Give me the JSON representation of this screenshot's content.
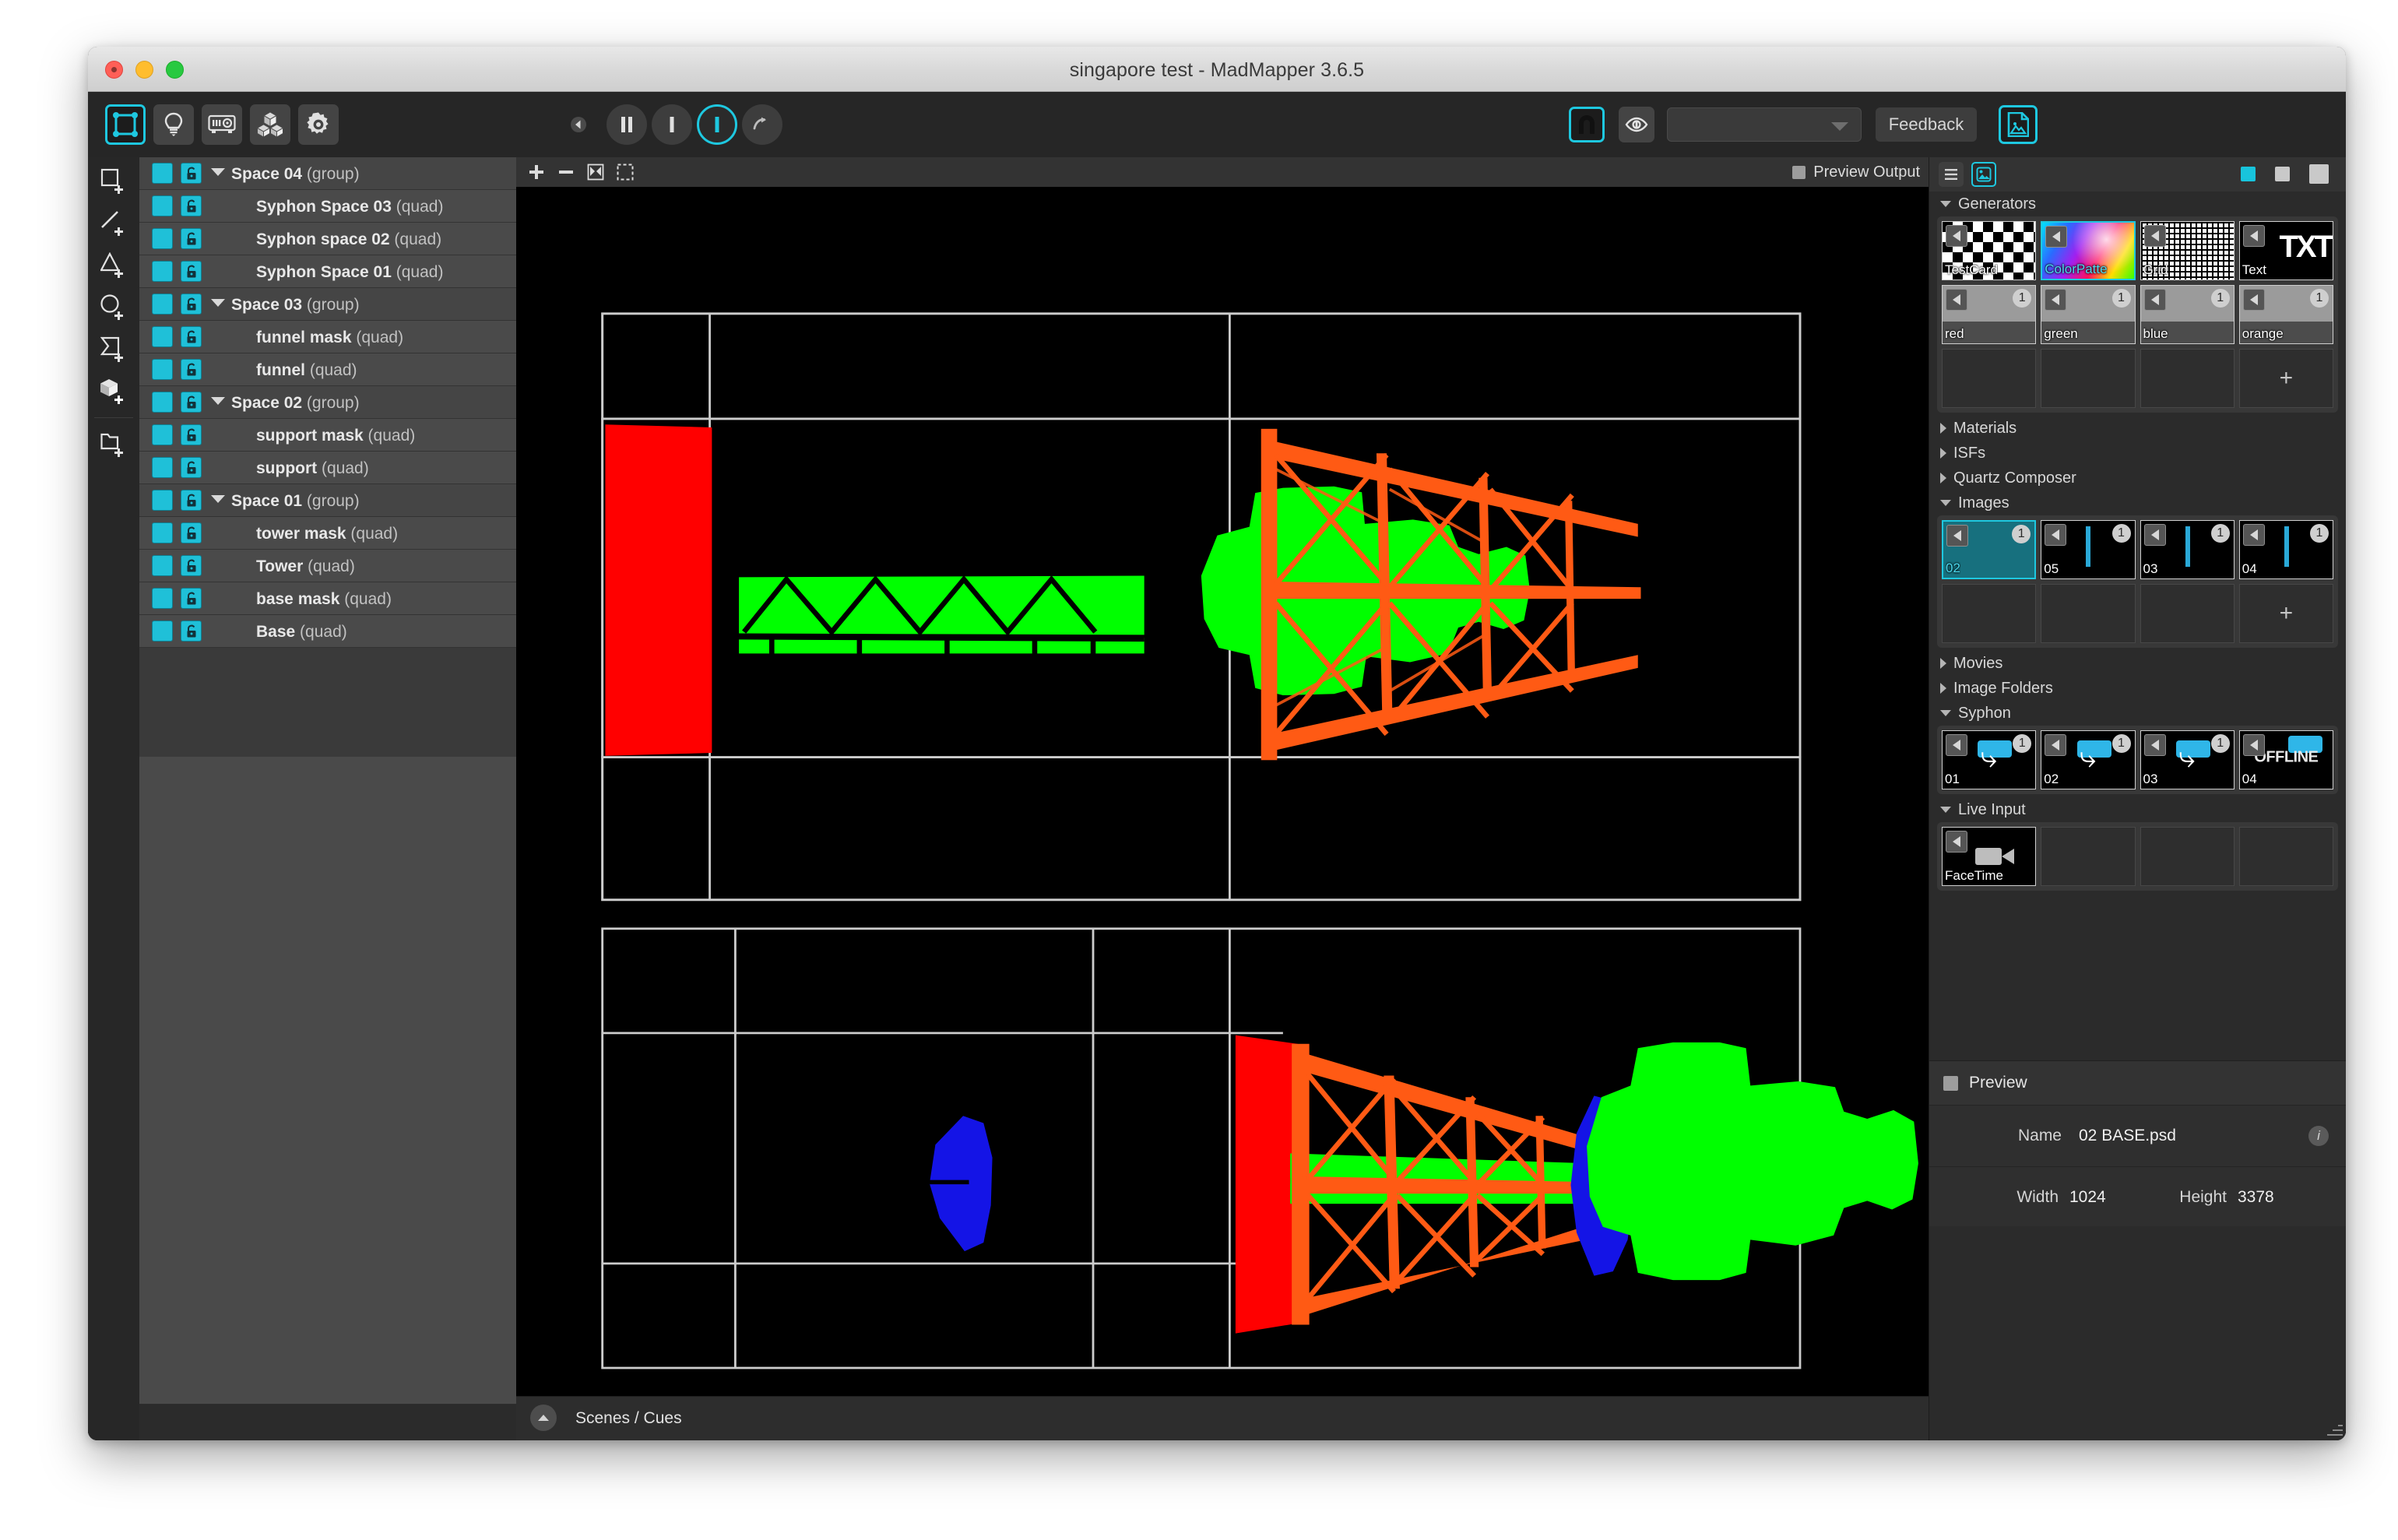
{
  "window": {
    "title": "singapore test - MadMapper 3.6.5",
    "traffic_lights": [
      "close-button",
      "minimize-button",
      "maximize-button"
    ]
  },
  "toolbar": {
    "left_tools": [
      {
        "name": "mapping-mode",
        "icon": "quad-mapping-icon",
        "active": true
      },
      {
        "name": "light-mode",
        "icon": "lightbulb-icon",
        "active": false
      },
      {
        "name": "output-mode",
        "icon": "projector-icon",
        "active": false
      },
      {
        "name": "modules-mode",
        "icon": "cubes-icon",
        "active": false
      },
      {
        "name": "preferences",
        "icon": "gear-icon",
        "active": false
      }
    ],
    "transport": [
      {
        "name": "collapse-transport",
        "icon": "chevron-left-icon",
        "active": false
      },
      {
        "name": "pause-button",
        "icon": "pause-icon",
        "active": false
      },
      {
        "name": "cue-button",
        "icon": "bar-icon",
        "active": false
      },
      {
        "name": "play-button",
        "icon": "bar-circle-icon",
        "active": true
      },
      {
        "name": "loop-button",
        "icon": "arc-arrow-icon",
        "active": false
      }
    ],
    "right_tools": [
      {
        "name": "snap-toggle",
        "icon": "magnet-icon",
        "active": true
      },
      {
        "name": "preview-eye",
        "icon": "eye-icon",
        "active": false
      }
    ],
    "dropdown_value": "",
    "dropdown_placeholder": "",
    "feedback_label": "Feedback",
    "media_button": {
      "name": "media-browser-toggle",
      "icon": "image-file-icon",
      "active": true
    }
  },
  "left_rail": {
    "tools": [
      {
        "name": "add-quad-tool",
        "icon": "add-quad-icon"
      },
      {
        "name": "add-line-tool",
        "icon": "add-line-icon"
      },
      {
        "name": "add-triangle-tool",
        "icon": "add-triangle-icon"
      },
      {
        "name": "add-circle-tool",
        "icon": "add-circle-icon"
      },
      {
        "name": "add-mask-tool",
        "icon": "add-mask-icon"
      },
      {
        "name": "add-cube-tool",
        "icon": "add-cube-icon"
      },
      {
        "name": "add-group-tool",
        "icon": "add-folder-icon"
      }
    ]
  },
  "layers": {
    "rows": [
      {
        "name": "Space 04",
        "type": "(group)",
        "group": true,
        "expanded": true
      },
      {
        "name": "Syphon Space 03",
        "type": "(quad)",
        "group": false
      },
      {
        "name": "Syphon space 02",
        "type": "(quad)",
        "group": false
      },
      {
        "name": "Syphon Space 01",
        "type": "(quad)",
        "group": false
      },
      {
        "name": "Space 03",
        "type": "(group)",
        "group": true,
        "expanded": true
      },
      {
        "name": "funnel mask",
        "type": "(quad)",
        "group": false
      },
      {
        "name": "funnel",
        "type": "(quad)",
        "group": false
      },
      {
        "name": "Space 02",
        "type": "(group)",
        "group": true,
        "expanded": true
      },
      {
        "name": "support mask",
        "type": "(quad)",
        "group": false
      },
      {
        "name": "support",
        "type": "(quad)",
        "group": false
      },
      {
        "name": "Space 01",
        "type": "(group)",
        "group": true,
        "expanded": true
      },
      {
        "name": "tower mask",
        "type": "(quad)",
        "group": false
      },
      {
        "name": "Tower",
        "type": "(quad)",
        "group": false
      },
      {
        "name": "base mask",
        "type": "(quad)",
        "group": false
      },
      {
        "name": "Base",
        "type": "(quad)",
        "group": false
      }
    ]
  },
  "canvas": {
    "tools": [
      {
        "name": "add-surface-button",
        "icon": "plus-icon"
      },
      {
        "name": "remove-surface-button",
        "icon": "minus-icon"
      },
      {
        "name": "fit-view-button",
        "icon": "fit-icon"
      },
      {
        "name": "select-area-button",
        "icon": "marquee-icon"
      }
    ],
    "preview_output_label": "Preview Output",
    "preview_output_checked": false,
    "scenes_label": "Scenes / Cues"
  },
  "right_panel": {
    "view_buttons": [
      {
        "name": "list-view-button",
        "icon": "list-icon",
        "active": false
      },
      {
        "name": "media-view-button",
        "icon": "image-icon",
        "active": true
      }
    ],
    "size_buttons": [
      {
        "name": "thumb-small-button",
        "accent": true
      },
      {
        "name": "thumb-medium-button",
        "accent": false
      },
      {
        "name": "thumb-large-button",
        "accent": false
      }
    ],
    "sections": [
      {
        "name": "Generators",
        "expanded": true,
        "items": [
          {
            "label": "TestCard",
            "art": "checker",
            "play": true,
            "badge": null,
            "selected": false
          },
          {
            "label": "ColorPatte",
            "art": "colorwheel",
            "play": true,
            "badge": null,
            "selected": true,
            "label_accent": true
          },
          {
            "label": "Grid",
            "art": "grid",
            "play": true,
            "badge": null,
            "selected": false
          },
          {
            "label": "Text",
            "art": "text",
            "play": true,
            "badge": null,
            "selected": false,
            "glyph": "TXT"
          },
          {
            "label": "red",
            "art": "gray",
            "play": true,
            "badge": "1",
            "selected": false
          },
          {
            "label": "green",
            "art": "gray",
            "play": true,
            "badge": "1",
            "selected": false
          },
          {
            "label": "blue",
            "art": "gray",
            "play": true,
            "badge": "1",
            "selected": false
          },
          {
            "label": "orange",
            "art": "gray",
            "play": true,
            "badge": "1",
            "selected": false
          },
          {
            "label": "",
            "art": "empty"
          },
          {
            "label": "",
            "art": "empty"
          },
          {
            "label": "",
            "art": "empty"
          },
          {
            "label": "",
            "art": "empty",
            "plus": true
          }
        ]
      },
      {
        "name": "Materials",
        "expanded": false,
        "items": []
      },
      {
        "name": "ISFs",
        "expanded": false,
        "items": []
      },
      {
        "name": "Quartz Composer",
        "expanded": false,
        "items": []
      },
      {
        "name": "Images",
        "expanded": true,
        "items": [
          {
            "label": "02",
            "art": "teal",
            "play": true,
            "badge": "1",
            "selected": true,
            "label_accent": true
          },
          {
            "label": "05",
            "art": "black",
            "play": true,
            "badge": "1",
            "selected": false
          },
          {
            "label": "03",
            "art": "black",
            "play": true,
            "badge": "1",
            "selected": false
          },
          {
            "label": "04",
            "art": "black",
            "play": true,
            "badge": "1",
            "selected": false
          },
          {
            "label": "",
            "art": "empty"
          },
          {
            "label": "",
            "art": "empty"
          },
          {
            "label": "",
            "art": "empty"
          },
          {
            "label": "",
            "art": "empty",
            "plus": true
          }
        ]
      },
      {
        "name": "Movies",
        "expanded": false,
        "items": []
      },
      {
        "name": "Image Folders",
        "expanded": false,
        "items": []
      },
      {
        "name": "Syphon",
        "expanded": true,
        "items": [
          {
            "label": "01",
            "art": "syphon",
            "play": true,
            "badge": "1",
            "selected": false
          },
          {
            "label": "02",
            "art": "syphon",
            "play": true,
            "badge": "1",
            "selected": false
          },
          {
            "label": "03",
            "art": "syphon",
            "play": true,
            "badge": "1",
            "selected": false
          },
          {
            "label": "04",
            "art": "offline",
            "play": true,
            "badge": null,
            "selected": false,
            "glyph": "OFFLINE"
          }
        ]
      },
      {
        "name": "Live Input",
        "expanded": true,
        "items": [
          {
            "label": "FaceTime",
            "art": "camera",
            "play": true,
            "badge": null,
            "selected": false
          },
          {
            "label": "",
            "art": "empty"
          },
          {
            "label": "",
            "art": "empty"
          },
          {
            "label": "",
            "art": "empty"
          }
        ]
      }
    ],
    "preview": {
      "title": "Preview",
      "checked": false,
      "name_label": "Name",
      "name_value": "02 BASE.psd",
      "width_label": "Width",
      "width_value": "1024",
      "height_label": "Height",
      "height_value": "3378",
      "info_glyph": "i"
    }
  },
  "colors": {
    "accent": "#1ec8e0",
    "layer_swatch": "#1fc0d8",
    "stage_red": "#ff0000",
    "stage_green": "#00ff00",
    "stage_blue": "#1414e6",
    "stage_orange": "#ff5a14",
    "guide_line": "#cccccc",
    "panel_bg": "#2b2b2b",
    "layer_bg": "#4a4a4a"
  }
}
